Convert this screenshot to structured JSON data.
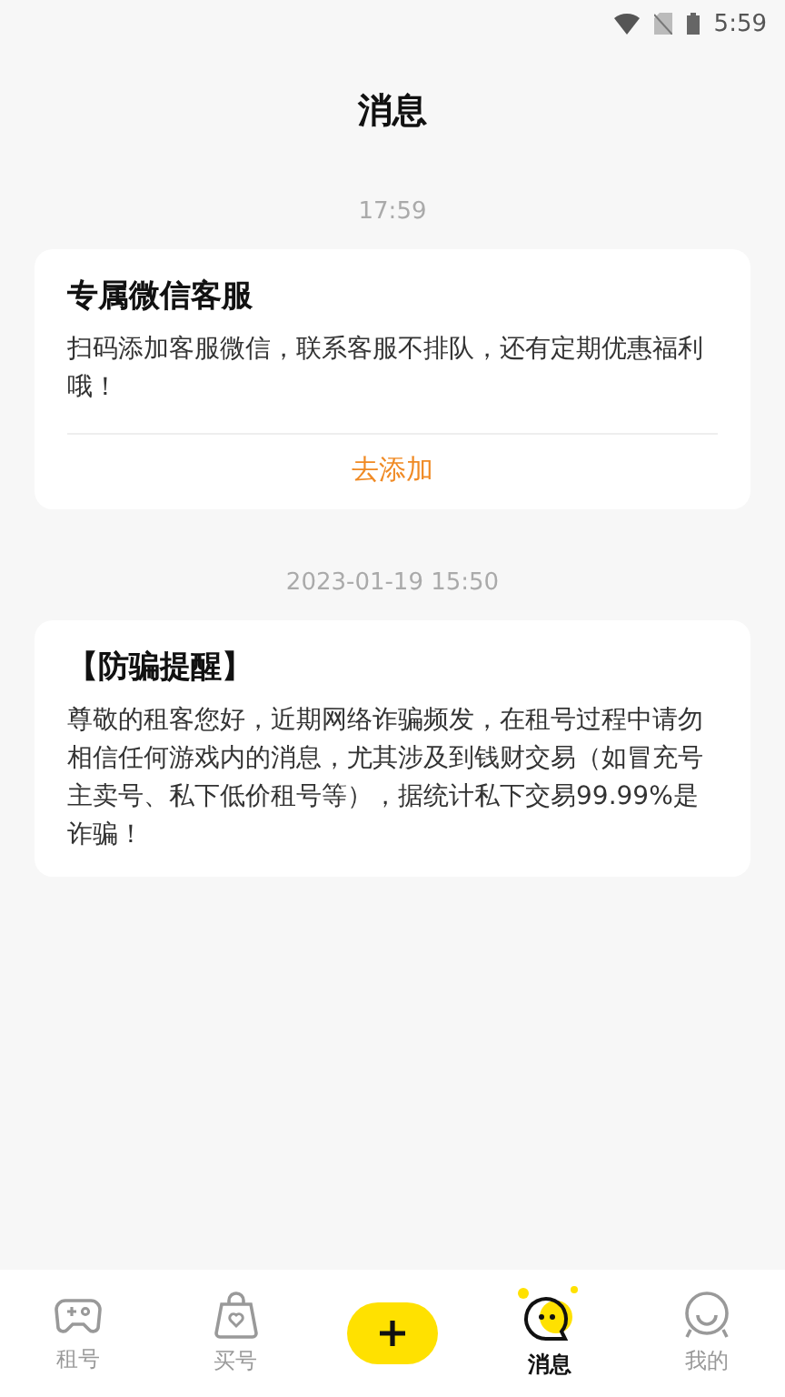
{
  "status_bar": {
    "time": "5:59"
  },
  "header": {
    "title": "消息"
  },
  "messages": [
    {
      "timestamp": "17:59",
      "title": "专属微信客服",
      "body": "扫码添加客服微信，联系客服不排队，还有定期优惠福利哦！",
      "action": "去添加"
    },
    {
      "timestamp": "2023-01-19 15:50",
      "title": "【防骗提醒】",
      "body": "尊敬的租客您好，近期网络诈骗频发，在租号过程中请勿相信任何游戏内的消息，尤其涉及到钱财交易（如冒充号主卖号、私下低价租号等），据统计私下交易99.99%是诈骗！"
    }
  ],
  "tab_bar": [
    {
      "kind": "game",
      "label": "租号",
      "selected": false
    },
    {
      "kind": "bag",
      "label": "买号",
      "selected": false
    },
    {
      "kind": "add",
      "selected": false
    },
    {
      "kind": "chat",
      "label": "消息",
      "selected": true
    },
    {
      "kind": "smile",
      "label": "我的",
      "selected": false
    }
  ]
}
